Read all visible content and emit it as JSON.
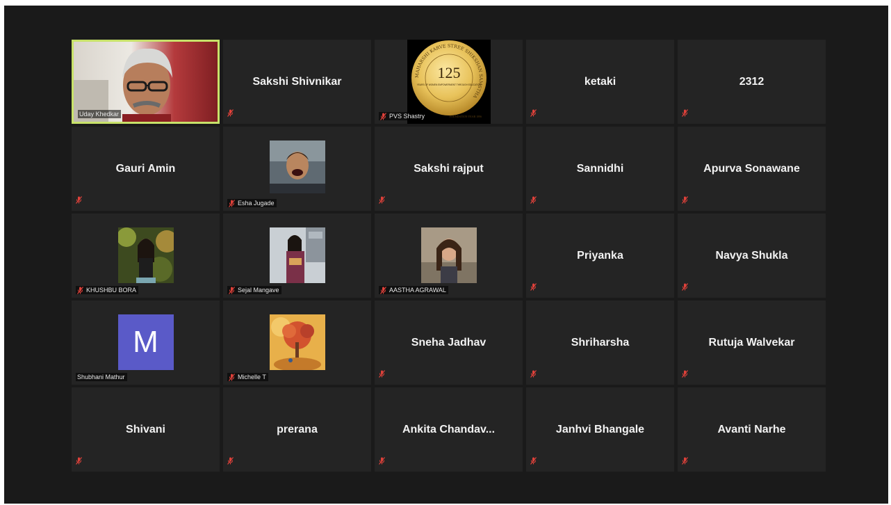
{
  "participants": [
    {
      "name": "Uday Khedkar",
      "kind": "video",
      "speaking": true
    },
    {
      "name": "Sakshi Shivnikar",
      "kind": "text"
    },
    {
      "name": "PVS Shastry",
      "kind": "logo",
      "logo": {
        "number": "125",
        "ring_text": "MAHARSHI KARVE STREE SHIKSHAN SAMSTHA",
        "tagline": "YEARS OF WOMEN EMPOWERMENT THROUGH EDUCATION",
        "founded": "FOUNDATION YEAR 1896"
      }
    },
    {
      "name": "ketaki",
      "kind": "text"
    },
    {
      "name": "2312",
      "kind": "text"
    },
    {
      "name": "Gauri Amin",
      "kind": "text"
    },
    {
      "name": "Esha Jugade",
      "kind": "photo",
      "photo": "man-laughing"
    },
    {
      "name": "Sakshi rajput",
      "kind": "text"
    },
    {
      "name": "Sannidhi",
      "kind": "text"
    },
    {
      "name": "Apurva Sonawane",
      "kind": "text"
    },
    {
      "name": "KHUSHBU BORA",
      "kind": "photo",
      "photo": "woman-garden"
    },
    {
      "name": "Sejal Mangave",
      "kind": "photo",
      "photo": "woman-balcony"
    },
    {
      "name": "AASTHA AGRAWAL",
      "kind": "photo",
      "photo": "woman-outdoor"
    },
    {
      "name": "Priyanka",
      "kind": "text"
    },
    {
      "name": "Navya Shukla",
      "kind": "text"
    },
    {
      "name": "Shubhani Mathur",
      "kind": "initial",
      "initial": "M",
      "muted": false
    },
    {
      "name": "Michelle T",
      "kind": "photo",
      "photo": "autumn-tree-illustration"
    },
    {
      "name": "Sneha Jadhav",
      "kind": "text"
    },
    {
      "name": "Shriharsha",
      "kind": "text"
    },
    {
      "name": "Rutuja Walvekar",
      "kind": "text"
    },
    {
      "name": "Shivani",
      "kind": "text"
    },
    {
      "name": "prerana",
      "kind": "text"
    },
    {
      "name": "Ankita  Chandav...",
      "kind": "text"
    },
    {
      "name": "Janhvi Bhangale",
      "kind": "text"
    },
    {
      "name": "Avanti Narhe",
      "kind": "text"
    }
  ],
  "colors": {
    "background": "#1a1a1a",
    "tile": "#242424",
    "active_speaker_border": "#c8e26a",
    "mute_icon": "#e0413a",
    "initial_avatar": "#5a5ac8"
  },
  "icons": {
    "mute": "muted-microphone-icon"
  }
}
